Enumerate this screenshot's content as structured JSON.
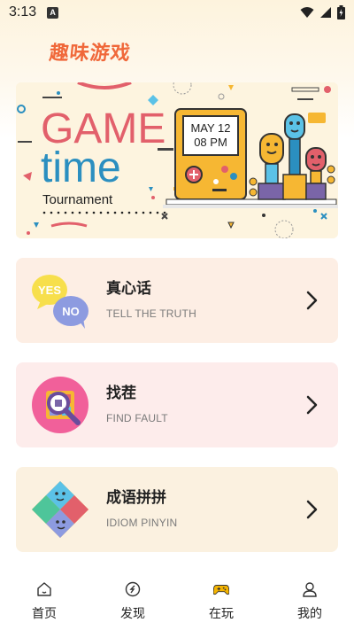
{
  "status_bar": {
    "time": "3:13",
    "notification_badge": "A"
  },
  "app": {
    "title": "趣味游戏"
  },
  "banner": {
    "line1": "GAME",
    "line2": "time",
    "line3": "Tournament",
    "screen_date": "MAY 12",
    "screen_time": "08 PM"
  },
  "games": [
    {
      "title": "真心话",
      "subtitle": "TELL THE TRUTH",
      "icon": "yes-no-bubbles-icon",
      "yes": "YES",
      "no": "NO"
    },
    {
      "title": "找茬",
      "subtitle": "FIND FAULT",
      "icon": "magnifier-puzzle-icon"
    },
    {
      "title": "成语拼拼",
      "subtitle": "IDIOM PINYIN",
      "icon": "jigsaw-puzzle-icon"
    }
  ],
  "tabs": [
    {
      "label": "首页",
      "icon": "home-icon"
    },
    {
      "label": "发现",
      "icon": "discover-icon"
    },
    {
      "label": "在玩",
      "icon": "gamepad-icon",
      "active": true
    },
    {
      "label": "我的",
      "icon": "profile-icon"
    }
  ],
  "colors": {
    "accent": "#f0683a",
    "banner_red": "#e2606b",
    "banner_blue": "#2b8fc0",
    "active_tab": "#f5b400"
  }
}
